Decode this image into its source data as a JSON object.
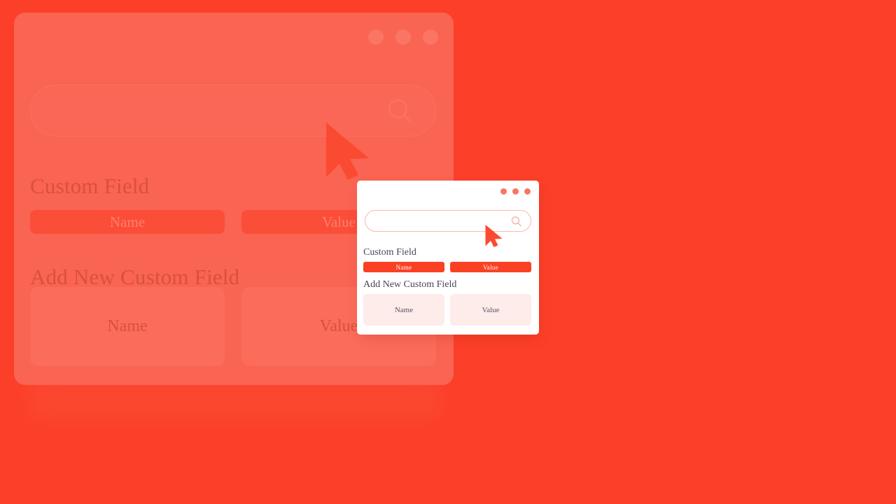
{
  "theme": {
    "page_background": "#FB3F29",
    "ghost_card_background": "#FA6452",
    "popup_background": "#FFFFFF",
    "accent_button": "#FB4124",
    "field_background": "#FDECEA",
    "dot_color": "#FB7563",
    "text_color": "#4A4458"
  },
  "background_window": {
    "name": "zoomed-background-window",
    "titlebar": {
      "dots": [
        "close-dot",
        "minimize-dot",
        "maximize-dot"
      ]
    },
    "search": {
      "value": "",
      "placeholder": "",
      "icon": "search-icon"
    },
    "sections": [
      {
        "heading": "Custom Field",
        "buttons": [
          {
            "label": "Name"
          },
          {
            "label": "Value"
          }
        ]
      },
      {
        "heading": "Add New Custom Field",
        "fields": [
          {
            "placeholder": "Name",
            "value": "Name"
          },
          {
            "placeholder": "Value",
            "value": "Value"
          }
        ]
      }
    ],
    "cursor": "arrow-pointer"
  },
  "popup_window": {
    "name": "custom-field-popup",
    "titlebar": {
      "dots": [
        "close-dot",
        "minimize-dot",
        "maximize-dot"
      ]
    },
    "search": {
      "value": "",
      "placeholder": "",
      "icon": "search-icon"
    },
    "sections": [
      {
        "heading": "Custom Field",
        "buttons": [
          {
            "label": "Name"
          },
          {
            "label": "Value"
          }
        ]
      },
      {
        "heading": "Add New Custom Field",
        "fields": [
          {
            "placeholder": "Name",
            "value": "Name"
          },
          {
            "placeholder": "Value",
            "value": "Value"
          }
        ]
      }
    ],
    "cursor": "arrow-pointer"
  }
}
